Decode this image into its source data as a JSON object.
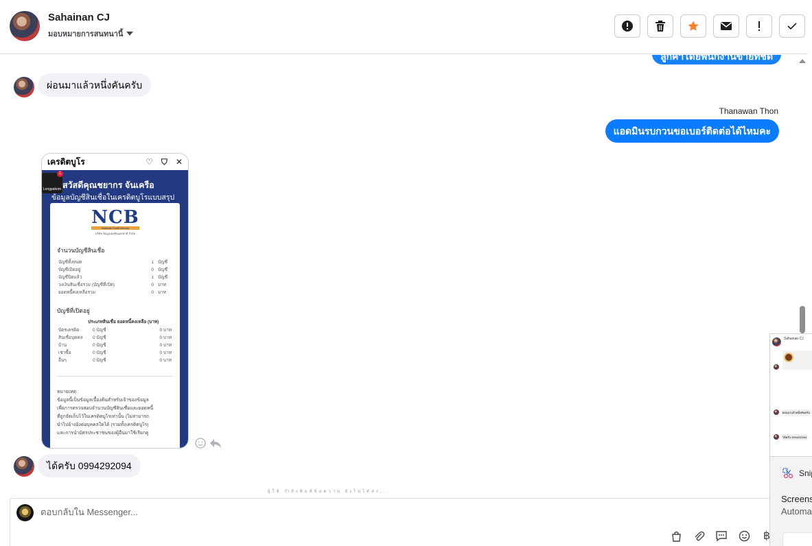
{
  "header": {
    "contact_name": "Sahainan CJ",
    "assign_label": "มอบหมายการสนทนานี้",
    "toolbar": [
      {
        "icon": "alert-circle-icon"
      },
      {
        "icon": "trash-icon"
      },
      {
        "icon": "star-icon",
        "color": "#f5822a"
      },
      {
        "icon": "envelope-icon"
      },
      {
        "icon": "exclamation-icon"
      },
      {
        "icon": "check-icon"
      }
    ]
  },
  "messages": {
    "outgoing_partial": "ลูกค้าโดยพนักงานขายที่ชัด",
    "incoming_1": "ผ่อนมาแล้วหนึ่งคันครับ",
    "sender_name": "Thanawan Thon",
    "outgoing_1": "แอดมินรบกวนขอเบอร์ติดต่อได้ไหมคะ",
    "incoming_2": "ได้ครับ 0994292094",
    "typing_hint": "ผู้ใช้ กำลังพิมพ์ข้อความ ยังไม่ได้ส่ง..."
  },
  "shared_image": {
    "app_title": "เครดิตบูโร",
    "greeting": "สวัสดีคุณชยากร จันเครือ",
    "subtitle": "ข้อมูลบัญชีสินเชื่อในเครดิตบูโรแบบสรุป",
    "badge_text": "Longpakorn",
    "badge_count": "1",
    "logo_word": "NCB",
    "logo_bar": "National Credit Bureau",
    "logo_small": "บริษัท ข้อมูลเครดิตแห่งชาติ จำกัด",
    "section1_title": "จำนวนบัญชีสินเชื่อ",
    "section1_rows": [
      {
        "k": "บัญชีทั้งหมด",
        "v": "1",
        "u": "บัญชี"
      },
      {
        "k": "บัญชีเปิดอยู่",
        "v": "0",
        "u": "บัญชี"
      },
      {
        "k": "บัญชีปิดแล้ว",
        "v": "1",
        "u": "บัญชี"
      },
      {
        "k": "วงเงินสินเชื่อรวม (บัญชีที่เปิด)",
        "v": "0",
        "u": "บาท"
      },
      {
        "k": "ยอดหนี้คงเหลือรวม",
        "v": "0",
        "u": "บาท"
      }
    ],
    "section2_title": "บัญชีที่เปิดอยู่",
    "section2_header": "ประเภทสินเชื่อ ยอดหนี้คงเหลือ (บาท)",
    "section2_rows": [
      {
        "k": "บัตรเครดิต",
        "m": "0 บัญชี",
        "r": "0 บาท"
      },
      {
        "k": "สินเชื่อบุคคล",
        "m": "0 บัญชี",
        "r": "0 บาท"
      },
      {
        "k": "บ้าน",
        "m": "0 บัญชี",
        "r": "0 บาท"
      },
      {
        "k": "เช่าซื้อ",
        "m": "0 บัญชี",
        "r": "0 บาท"
      },
      {
        "k": "อื่นๆ",
        "m": "0 บัญชี",
        "r": "0 บาท"
      }
    ],
    "note_title": "หมายเหตุ :",
    "note_lines": [
      "ข้อมูลนี้เป็นข้อมูลเบื้องต้นสำหรับเจ้าของข้อมูล",
      "เพื่อการตรวจสอบจำนวนบัญชีสินเชื่อและยอดหนี้",
      "ที่ถูกจัดเก็บไว้ในเครดิตบูโรเท่านั้น (ไม่สามารถ",
      "นำไปอ้างอิงต่อบุคคลใดได้ (รวมทั้งเครดิตบูโร)",
      "และการนำบัตรประชาชนของผู้อื่นมาใช้เรียกดู"
    ]
  },
  "composer": {
    "placeholder": "ตอบกลับใน Messenger...",
    "tools": [
      "bag-icon",
      "paperclip-icon",
      "chat-bubble-icon",
      "emoji-icon",
      "baht-icon"
    ]
  },
  "snip": {
    "thumb_name": "Sahainan CJ",
    "thumb_msg_1": "ผ่อนมาแล้วหนึ่งคันครับ",
    "thumb_msg_2": "ได้ครับ 0994292094",
    "app_label": "Snipping Tool",
    "title": "Screenshot copied to clipboard",
    "subtitle": "Automatically saved to screenshots folder"
  }
}
